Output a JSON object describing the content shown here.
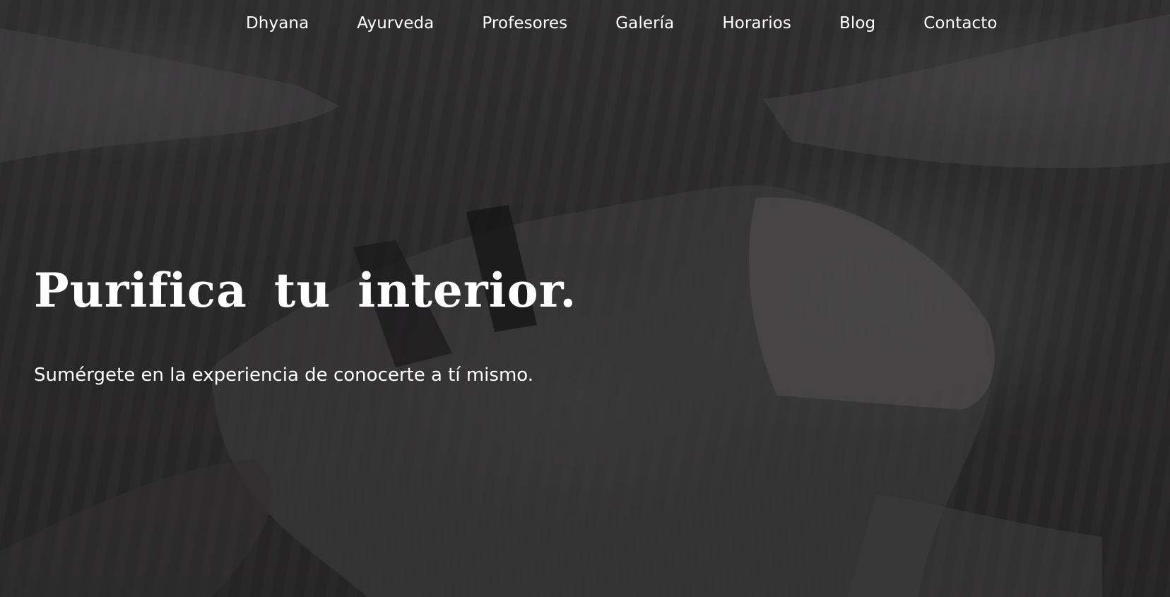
{
  "nav": {
    "items": [
      {
        "label": "Dhyana"
      },
      {
        "label": "Ayurveda"
      },
      {
        "label": "Profesores"
      },
      {
        "label": "Galería"
      },
      {
        "label": "Horarios"
      },
      {
        "label": "Blog"
      },
      {
        "label": "Contacto"
      }
    ]
  },
  "hero": {
    "title": "Purifica tu interior.",
    "subtitle": "Sumérgete en la experiencia de conocerte a tí mismo.",
    "background_image": "black-and-white yoga class photo, person in child's pose on wooden floor",
    "overlay_color": "#1e1c1e"
  }
}
